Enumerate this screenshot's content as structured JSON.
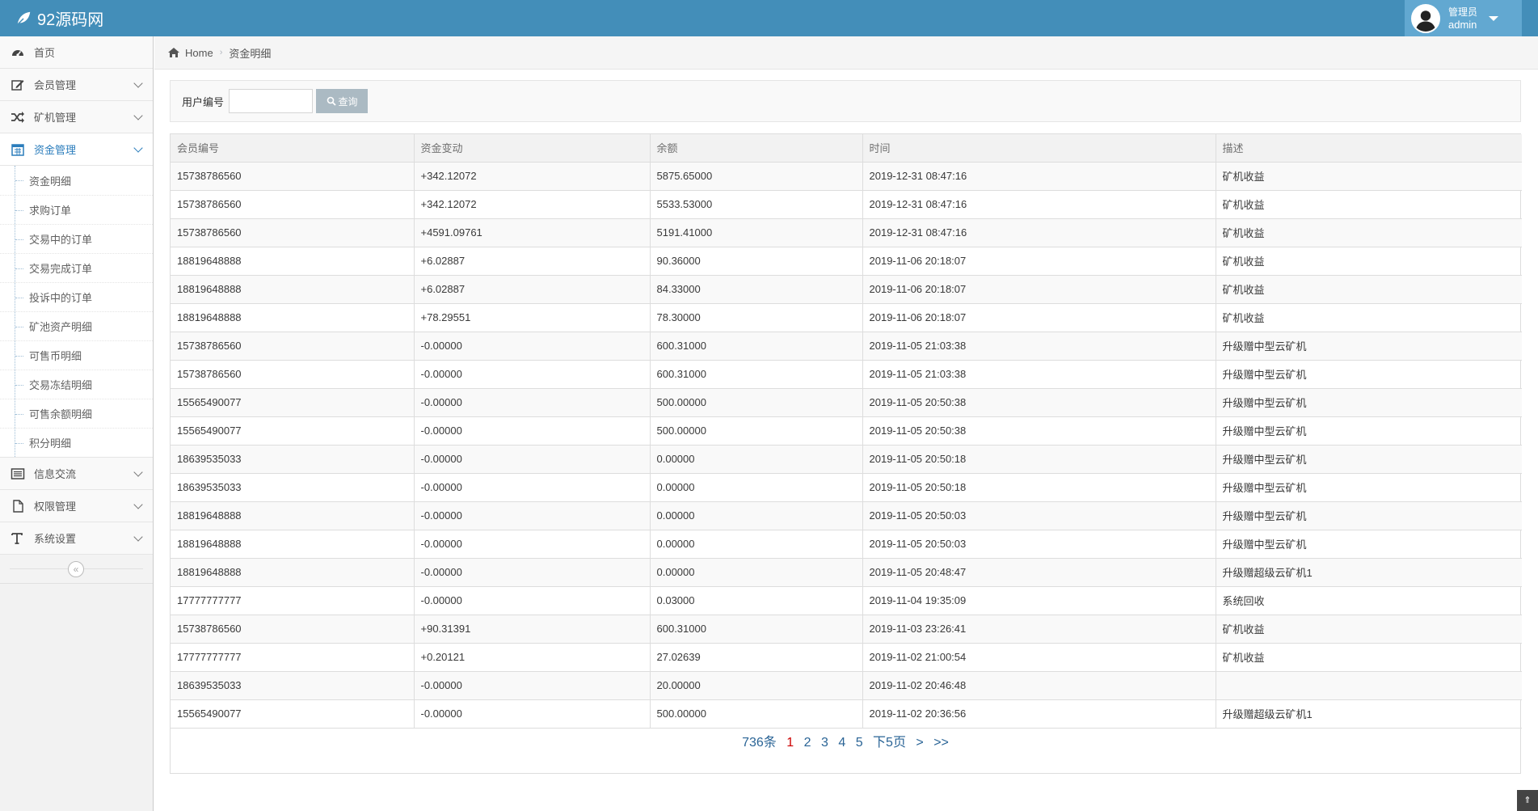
{
  "navbar": {
    "brand": "92源码网",
    "user_role": "管理员",
    "user_name": "admin"
  },
  "sidebar": {
    "items": [
      {
        "label": "首页",
        "icon": "dashboard-icon"
      },
      {
        "label": "会员管理",
        "icon": "edit-icon"
      },
      {
        "label": "矿机管理",
        "icon": "random-icon"
      },
      {
        "label": "资金管理",
        "icon": "calendar-icon"
      },
      {
        "label": "信息交流",
        "icon": "list-alt-icon"
      },
      {
        "label": "权限管理",
        "icon": "file-icon"
      },
      {
        "label": "系统设置",
        "icon": "text-height-icon"
      }
    ],
    "submenu": [
      "资金明细",
      "求购订单",
      "交易中的订单",
      "交易完成订单",
      "投诉中的订单",
      "矿池资产明细",
      "可售币明细",
      "交易冻结明细",
      "可售余额明细",
      "积分明细"
    ]
  },
  "breadcrumb": {
    "home": "Home",
    "current": "资金明细"
  },
  "search": {
    "label": "用户编号",
    "value": "",
    "button": "查询"
  },
  "table": {
    "headers": [
      "会员编号",
      "资金变动",
      "余额",
      "时间",
      "描述"
    ],
    "rows": [
      [
        "15738786560",
        "+342.12072",
        "5875.65000",
        "2019-12-31 08:47:16",
        "矿机收益"
      ],
      [
        "15738786560",
        "+342.12072",
        "5533.53000",
        "2019-12-31 08:47:16",
        "矿机收益"
      ],
      [
        "15738786560",
        "+4591.09761",
        "5191.41000",
        "2019-12-31 08:47:16",
        "矿机收益"
      ],
      [
        "18819648888",
        "+6.02887",
        "90.36000",
        "2019-11-06 20:18:07",
        "矿机收益"
      ],
      [
        "18819648888",
        "+6.02887",
        "84.33000",
        "2019-11-06 20:18:07",
        "矿机收益"
      ],
      [
        "18819648888",
        "+78.29551",
        "78.30000",
        "2019-11-06 20:18:07",
        "矿机收益"
      ],
      [
        "15738786560",
        "-0.00000",
        "600.31000",
        "2019-11-05 21:03:38",
        "升级赠中型云矿机"
      ],
      [
        "15738786560",
        "-0.00000",
        "600.31000",
        "2019-11-05 21:03:38",
        "升级赠中型云矿机"
      ],
      [
        "15565490077",
        "-0.00000",
        "500.00000",
        "2019-11-05 20:50:38",
        "升级赠中型云矿机"
      ],
      [
        "15565490077",
        "-0.00000",
        "500.00000",
        "2019-11-05 20:50:38",
        "升级赠中型云矿机"
      ],
      [
        "18639535033",
        "-0.00000",
        "0.00000",
        "2019-11-05 20:50:18",
        "升级赠中型云矿机"
      ],
      [
        "18639535033",
        "-0.00000",
        "0.00000",
        "2019-11-05 20:50:18",
        "升级赠中型云矿机"
      ],
      [
        "18819648888",
        "-0.00000",
        "0.00000",
        "2019-11-05 20:50:03",
        "升级赠中型云矿机"
      ],
      [
        "18819648888",
        "-0.00000",
        "0.00000",
        "2019-11-05 20:50:03",
        "升级赠中型云矿机"
      ],
      [
        "18819648888",
        "-0.00000",
        "0.00000",
        "2019-11-05 20:48:47",
        "升级赠超级云矿机1"
      ],
      [
        "17777777777",
        "-0.00000",
        "0.03000",
        "2019-11-04 19:35:09",
        "系统回收"
      ],
      [
        "15738786560",
        "+90.31391",
        "600.31000",
        "2019-11-03 23:26:41",
        "矿机收益"
      ],
      [
        "17777777777",
        "+0.20121",
        "27.02639",
        "2019-11-02 21:00:54",
        "矿机收益"
      ],
      [
        "18639535033",
        "-0.00000",
        "20.00000",
        "2019-11-02 20:46:48",
        ""
      ],
      [
        "15565490077",
        "-0.00000",
        "500.00000",
        "2019-11-02 20:36:56",
        "升级赠超级云矿机1"
      ]
    ]
  },
  "pagination": {
    "total": "736条",
    "pages": [
      "1",
      "2",
      "3",
      "4",
      "5"
    ],
    "current": "1",
    "next5": "下5页",
    "next": ">",
    "last": ">>"
  },
  "colors": {
    "navbar": "#438eb9",
    "link": "#2a6496",
    "active_menu": "#2b7dbc"
  }
}
